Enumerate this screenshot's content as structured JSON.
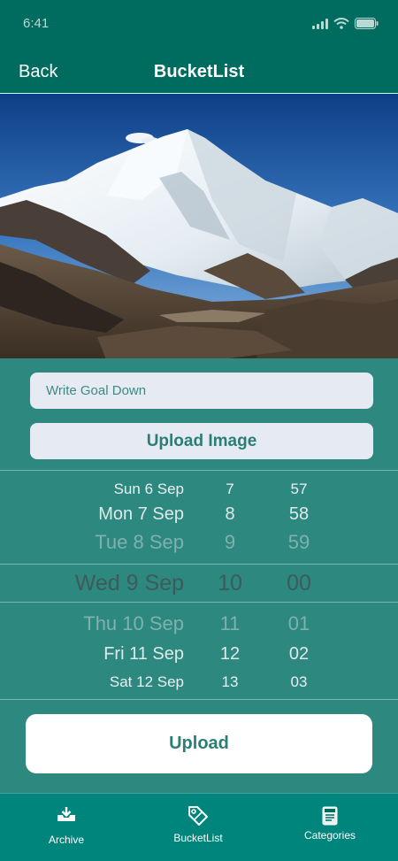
{
  "status_bar": {
    "time": "6:41"
  },
  "nav": {
    "back_label": "Back",
    "title": "BucketList"
  },
  "hero": {
    "subject": "mountain-photo"
  },
  "form": {
    "goal_placeholder": "Write Goal Down",
    "upload_image_label": "Upload Image"
  },
  "picker": {
    "rows": [
      {
        "date": "Sun 6 Sep",
        "hour": "7",
        "minute": "57"
      },
      {
        "date": "Mon 7 Sep",
        "hour": "8",
        "minute": "58"
      },
      {
        "date": "Tue 8 Sep",
        "hour": "9",
        "minute": "59"
      },
      {
        "date": "Wed 9 Sep",
        "hour": "10",
        "minute": "00"
      },
      {
        "date": "Thu 10 Sep",
        "hour": "11",
        "minute": "01"
      },
      {
        "date": "Fri 11 Sep",
        "hour": "12",
        "minute": "02"
      },
      {
        "date": "Sat 12 Sep",
        "hour": "13",
        "minute": "03"
      }
    ]
  },
  "upload_label": "Upload",
  "tabs": [
    {
      "label": "Archive",
      "icon": "archive-tray-icon"
    },
    {
      "label": "BucketList",
      "icon": "tag-icon"
    },
    {
      "label": "Categories",
      "icon": "document-icon"
    }
  ],
  "colors": {
    "header": "#006b5f",
    "background": "#2d8880",
    "tabbar": "#00857c",
    "field": "#e6eaf3",
    "accent_text": "#2b7e77"
  }
}
